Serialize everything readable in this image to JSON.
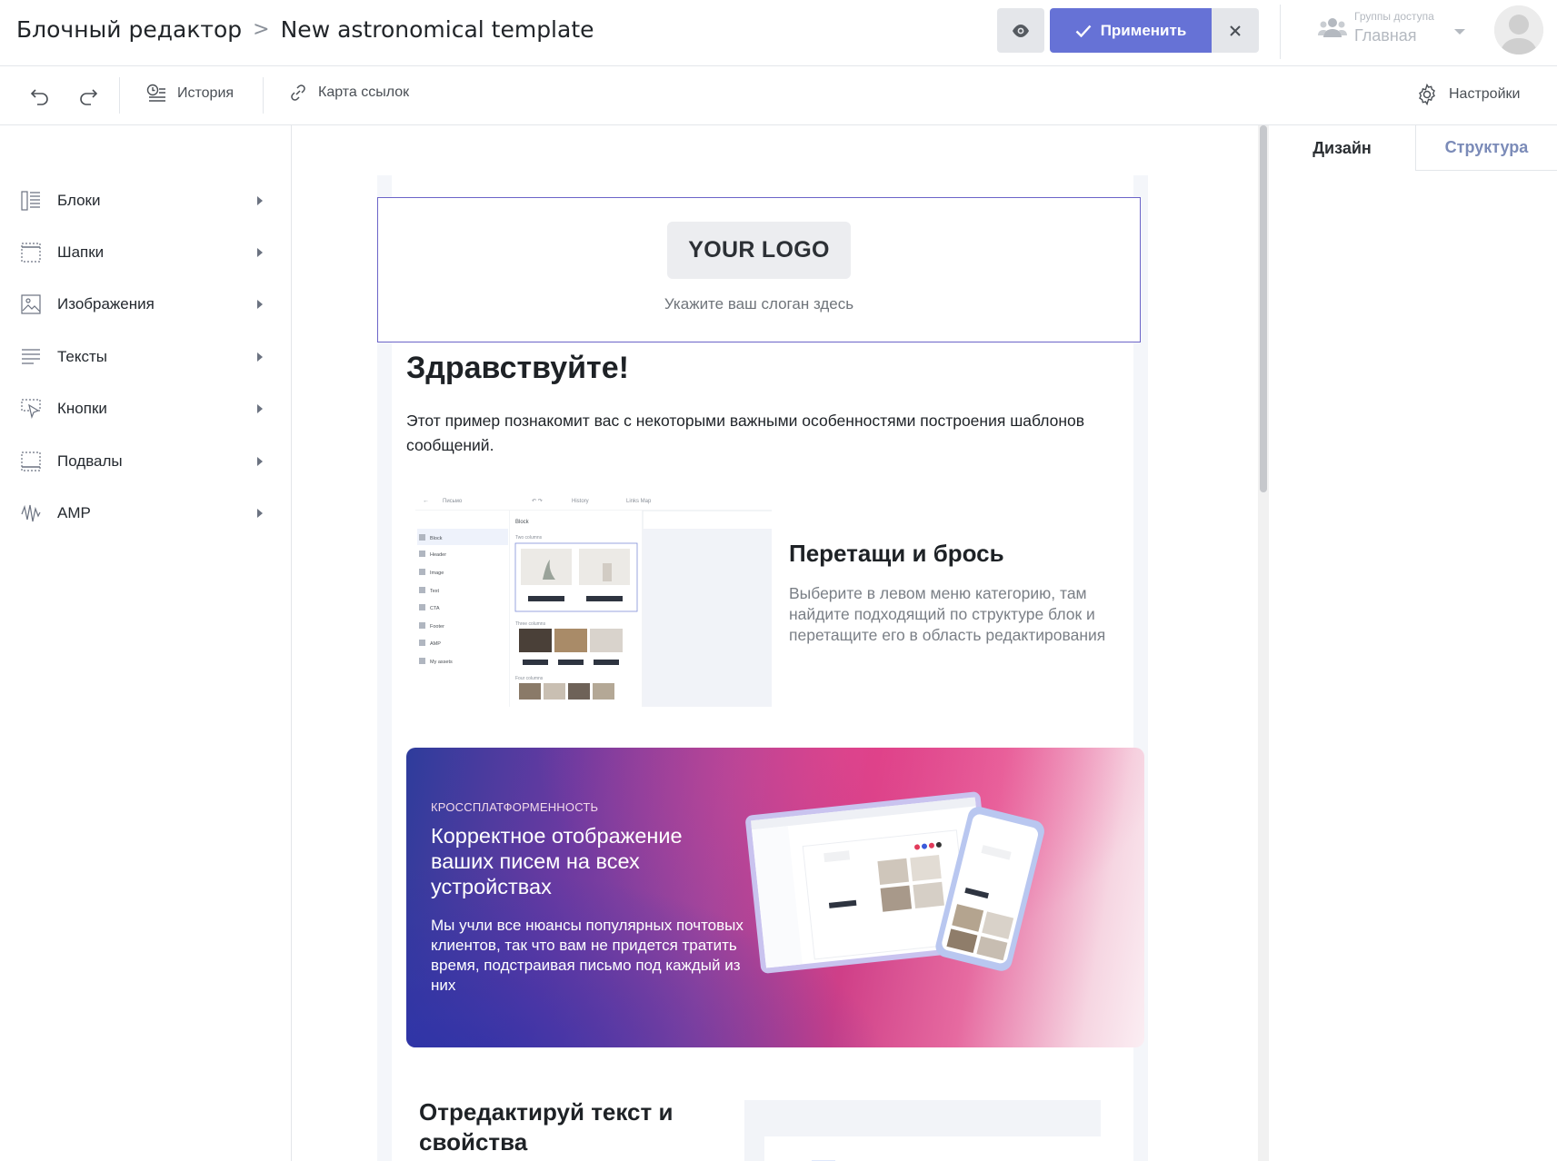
{
  "header": {
    "breadcrumb_root": "Блочный редактор",
    "breadcrumb_current": "New astronomical template",
    "apply_label": "Применить",
    "access_label": "Группы доступа",
    "access_value": "Главная"
  },
  "toolbar": {
    "history_label": "История",
    "links_map_label": "Карта ссылок",
    "settings_label": "Настройки"
  },
  "sidebar": {
    "items": [
      {
        "label": "Блоки",
        "icon": "blocks-icon"
      },
      {
        "label": "Шапки",
        "icon": "header-icon"
      },
      {
        "label": "Изображения",
        "icon": "image-icon"
      },
      {
        "label": "Тексты",
        "icon": "text-icon"
      },
      {
        "label": "Кнопки",
        "icon": "cta-icon"
      },
      {
        "label": "Подвалы",
        "icon": "footer-icon"
      },
      {
        "label": "AMP",
        "icon": "amp-icon"
      }
    ]
  },
  "email": {
    "logo_text": "YOUR LOGO",
    "slogan": "Укажите ваш слоган здесь",
    "greeting": "Здравствуйте!",
    "intro": "Этот пример познакомит вас с некоторыми важными особенностями построения шаблонов сообщений.",
    "drag_title": "Перетащи и брось",
    "drag_text": "Выберите в левом меню категорию, там найдите подходящий по структуре блок и перетащите его в область редактирования",
    "banner_kicker": "КРОССПЛАТФОРМЕННОСТЬ",
    "banner_title": "Корректное отображение ваших писем на всех устройствах",
    "banner_text": "Мы учли все нюансы популярных почтовых клиентов, так что вам не придется тратить время, подстраивая письмо под каждый из них",
    "edit_title": "Отредактируй текст и свойства",
    "edit_color_value": "#425466",
    "edit_font_size": "24"
  },
  "screenshot_mini": {
    "topbar_label": "Письмо",
    "history": "History",
    "links": "Links Map",
    "panel_title": "Block",
    "two_columns": "Two columns",
    "three_columns": "Three columns",
    "four_columns": "Four columns",
    "menu": [
      "Block",
      "Header",
      "Image",
      "Text",
      "CTA",
      "Footer",
      "AMP",
      "My assets"
    ]
  },
  "right_panel": {
    "tab_design": "Дизайн",
    "tab_structure": "Структура"
  },
  "colors": {
    "accent": "#6672d6",
    "selection": "#6b64c8",
    "muted": "#b4b9c0"
  }
}
